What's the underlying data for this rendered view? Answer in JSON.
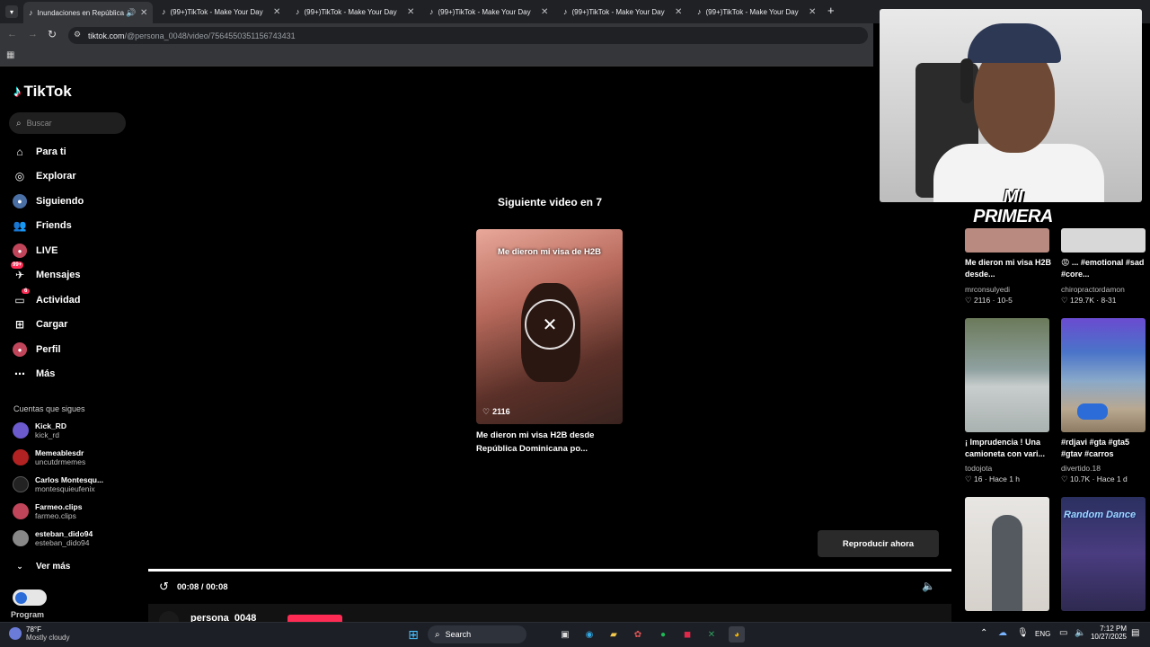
{
  "browser": {
    "active_tab": "Inundaciones en República",
    "tabs": [
      "(99+)TikTok - Make Your Day",
      "(99+)TikTok - Make Your Day",
      "(99+)TikTok - Make Your Day",
      "(99+)TikTok - Make Your Day",
      "(99+)TikTok - Make Your Day"
    ],
    "url_host": "tiktok.com",
    "url_path": "/@persona_0048/video/7564550351156743431",
    "new_tab": "+"
  },
  "sidebar": {
    "logo": "TikTok",
    "search_placeholder": "Buscar",
    "items": [
      {
        "label": "Para ti",
        "icon": "home-icon"
      },
      {
        "label": "Explorar",
        "icon": "compass-icon"
      },
      {
        "label": "Siguiendo",
        "icon": "following-icon"
      },
      {
        "label": "Friends",
        "icon": "friends-icon"
      },
      {
        "label": "LIVE",
        "icon": "live-icon"
      },
      {
        "label": "Mensajes",
        "icon": "messages-icon",
        "badge": "99+"
      },
      {
        "label": "Actividad",
        "icon": "activity-icon",
        "badge": "6"
      },
      {
        "label": "Cargar",
        "icon": "upload-icon"
      },
      {
        "label": "Perfil",
        "icon": "profile-icon"
      },
      {
        "label": "Más",
        "icon": "more-icon"
      }
    ],
    "following_header": "Cuentas que sigues",
    "following": [
      {
        "name": "Kick_RD",
        "handle": "kick_rd"
      },
      {
        "name": "Memeablesdr",
        "handle": "uncutdrmemes"
      },
      {
        "name": "Carlos Montesqu...",
        "handle": "montesquieufenix"
      },
      {
        "name": "Farmeo.clips",
        "handle": "farmeo.clips"
      },
      {
        "name": "esteban_dido94",
        "handle": "esteban_dido94"
      }
    ],
    "see_more": "Ver más",
    "program": "Program"
  },
  "player": {
    "next_label": "Siguiente video en 7",
    "card_caption": "Me dieron mi visa de H2B",
    "card_likes": "2116",
    "card_title": "Me dieron mi visa H2B desde República Dominicana po...",
    "play_now": "Reproducir ahora",
    "time": "00:08 / 00:08",
    "author": "persona_0048"
  },
  "streamer_overlay": {
    "text": "MI PRIMERA CASA"
  },
  "grid": [
    {
      "title": "Me dieron mi visa H2B desde...",
      "author": "mrconsulyedi",
      "likes": "2116",
      "date": "10-5"
    },
    {
      "title": "😡 ... #emotional #sad #core...",
      "author": "chiropractordamon",
      "likes": "129.7K",
      "date": "8-31"
    },
    {
      "title": "¡ Imprudencia ! Una camioneta con vari...",
      "author": "todojota",
      "likes": "16",
      "date": "Hace 1 h"
    },
    {
      "title": "#rdjavi #gta #gta5 #gtav #carros",
      "author": "divertido.18",
      "likes": "10.7K",
      "date": "Hace 1 d"
    },
    {
      "title": "",
      "author": "",
      "likes": "",
      "date": ""
    },
    {
      "title": "",
      "author": "",
      "likes": "",
      "date": ""
    }
  ],
  "grid_banner": "Random Dance",
  "taskbar": {
    "weather_temp": "78°F",
    "weather_desc": "Mostly cloudy",
    "search": "Search",
    "lang": "ENG",
    "time": "7:12 PM",
    "date": "10/27/2025"
  }
}
